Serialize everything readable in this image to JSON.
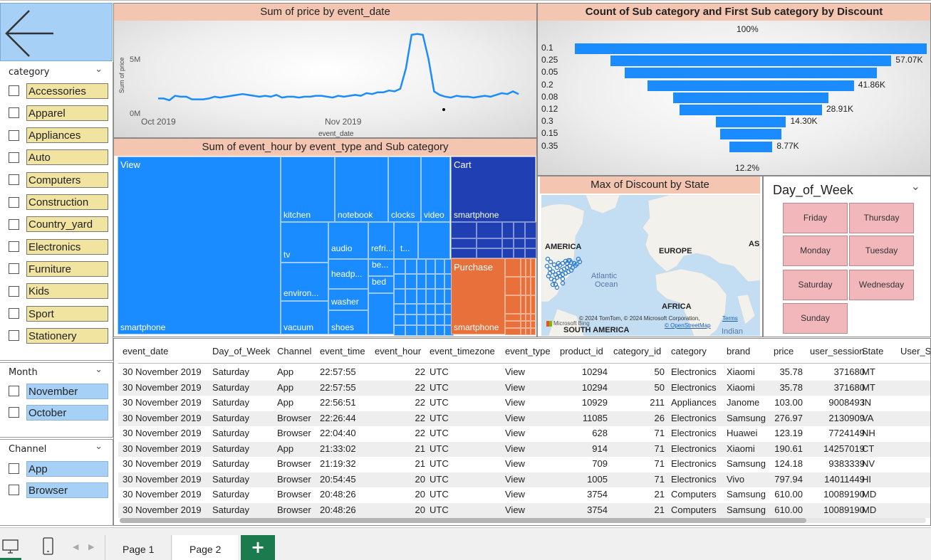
{
  "back_button": {
    "icon": "arrow-left-icon"
  },
  "category_slicer": {
    "title": "category",
    "items": [
      "Accessories",
      "Apparel",
      "Appliances",
      "Auto",
      "Computers",
      "Construction",
      "Country_yard",
      "Electronics",
      "Furniture",
      "Kids",
      "Sport",
      "Stationery"
    ]
  },
  "month_slicer": {
    "title": "Month",
    "items": [
      "November",
      "October"
    ]
  },
  "channel_slicer": {
    "title": "Channel",
    "items": [
      "App",
      "Browser"
    ]
  },
  "line_chart": {
    "title": "Sum of price by event_date",
    "chart_data": {
      "type": "line",
      "xlabel": "event_date",
      "ylabel": "Sum of price",
      "x_ticks": [
        "Oct 2019",
        "Nov 2019"
      ],
      "y_ticks": [
        "0M",
        "5M"
      ],
      "values_m": [
        1.5,
        1.5,
        1.3,
        1.8,
        1.7,
        1.7,
        1.4,
        1.4,
        1.4,
        1.5,
        1.7,
        1.6,
        1.7,
        1.8,
        1.9,
        2.0,
        1.9,
        1.8,
        1.7,
        1.8,
        1.7,
        1.9,
        1.6,
        1.7,
        1.7,
        1.6,
        1.7,
        1.7,
        1.8,
        1.8,
        1.7,
        1.6,
        1.8,
        1.7,
        1.8,
        1.9,
        1.8,
        2.1,
        2.0,
        2.2,
        2.2,
        2.4,
        2.3,
        2.6,
        4.9,
        8.7,
        8.8,
        8.7,
        6.0,
        2.3,
        1.9,
        1.7,
        1.6,
        1.8,
        1.7,
        1.7,
        1.6,
        1.7,
        1.8,
        1.7,
        1.9,
        2.1,
        2.0,
        2.3,
        2.0
      ],
      "color": "#1a8cff"
    }
  },
  "funnel_chart": {
    "title": "Count of Sub category and First Sub category by Discount",
    "top_pct": "100%",
    "bottom_pct": "12.2%",
    "chart_data": {
      "type": "bar",
      "categories": [
        "0.1",
        "0.25",
        "0.05",
        "0.2",
        "0.08",
        "0.12",
        "0.3",
        "0.15",
        "0.35"
      ],
      "values_k": [
        71.4,
        57.07,
        51.2,
        41.86,
        31.5,
        28.91,
        14.3,
        12.3,
        8.77
      ],
      "data_labels": [
        "",
        "57.07K",
        "",
        "41.86K",
        "",
        "28.91K",
        "14.30K",
        "",
        "8.77K"
      ],
      "color": "#1a8cff"
    }
  },
  "treemap": {
    "title": "Sum of event_hour by event_type and Sub category",
    "groups": [
      {
        "name": "View",
        "color": "#1a8cff"
      },
      {
        "name": "Cart",
        "color": "#1f3fb3"
      },
      {
        "name": "Purchase",
        "color": "#e8703a"
      }
    ],
    "labels": [
      "smartphone",
      "kitchen",
      "notebook",
      "clocks",
      "video",
      "tv",
      "audio",
      "refri...",
      "t...",
      "be...",
      "bed",
      "headp...",
      "environ...",
      "washer",
      "vacuum",
      "shoes",
      "smartphone",
      "smartphone"
    ]
  },
  "map": {
    "title": "Max of Discount by State",
    "labels": [
      "AMERICA",
      "EUROPE",
      "AS",
      "Atlantic",
      "Ocean",
      "AFRICA",
      "SOUTH AMERICA",
      "Indian"
    ],
    "attribution": "© 2024 TomTom, © 2024 Microsoft Corporation,",
    "terms": "Terms",
    "osm": "© OpenStreetMap",
    "bing": "Microsoft Bing"
  },
  "dow_slicer": {
    "title": "Day_of_Week",
    "items": [
      "Friday",
      "Thursday",
      "Monday",
      "Tuesday",
      "Saturday",
      "Wednesday",
      "Sunday"
    ]
  },
  "table": {
    "columns": [
      "event_date",
      "Day_of_Week",
      "Channel",
      "event_time",
      "event_hour",
      "event_timezone",
      "event_type",
      "product_id",
      "category_id",
      "category",
      "brand",
      "price",
      "user_session",
      "State",
      "User_S"
    ],
    "rows": [
      [
        "30 November 2019",
        "Saturday",
        "App",
        "22:57:55",
        "22",
        "UTC",
        "View",
        "10294",
        "50",
        "Electronics",
        "Xiaomi",
        "35.78",
        "371680",
        "MT"
      ],
      [
        "30 November 2019",
        "Saturday",
        "App",
        "22:57:55",
        "22",
        "UTC",
        "View",
        "10294",
        "50",
        "Electronics",
        "Xiaomi",
        "35.78",
        "371680",
        "MT"
      ],
      [
        "30 November 2019",
        "Saturday",
        "App",
        "22:56:51",
        "22",
        "UTC",
        "View",
        "10929",
        "211",
        "Appliances",
        "Janome",
        "103.00",
        "9008493",
        "IN"
      ],
      [
        "30 November 2019",
        "Saturday",
        "Browser",
        "22:26:44",
        "22",
        "UTC",
        "View",
        "11085",
        "26",
        "Electronics",
        "Samsung",
        "276.97",
        "2130909",
        "VA"
      ],
      [
        "30 November 2019",
        "Saturday",
        "Browser",
        "22:04:40",
        "22",
        "UTC",
        "View",
        "628",
        "71",
        "Electronics",
        "Huawei",
        "123.19",
        "7724149",
        "NH"
      ],
      [
        "30 November 2019",
        "Saturday",
        "App",
        "21:33:02",
        "21",
        "UTC",
        "View",
        "914",
        "71",
        "Electronics",
        "Xiaomi",
        "190.61",
        "14257019",
        "CT"
      ],
      [
        "30 November 2019",
        "Saturday",
        "Browser",
        "21:19:32",
        "21",
        "UTC",
        "View",
        "709",
        "71",
        "Electronics",
        "Samsung",
        "124.18",
        "9383339",
        "NV"
      ],
      [
        "30 November 2019",
        "Saturday",
        "Browser",
        "20:54:45",
        "20",
        "UTC",
        "View",
        "1005",
        "71",
        "Electronics",
        "Vivo",
        "797.94",
        "14011449",
        "HI"
      ],
      [
        "30 November 2019",
        "Saturday",
        "Browser",
        "20:48:26",
        "20",
        "UTC",
        "View",
        "3754",
        "21",
        "Computers",
        "Samsung",
        "610.00",
        "10089190",
        "MD"
      ],
      [
        "30 November 2019",
        "Saturday",
        "Browser",
        "20:48:26",
        "20",
        "UTC",
        "View",
        "3754",
        "21",
        "Computers",
        "Samsung",
        "610.00",
        "10089190",
        "MD"
      ]
    ]
  },
  "footer": {
    "desktop_icon": "desktop-icon",
    "phone_icon": "phone-icon",
    "pages": [
      "Page 1",
      "Page 2"
    ],
    "add": "+",
    "add_color": "#1b7a4e"
  }
}
